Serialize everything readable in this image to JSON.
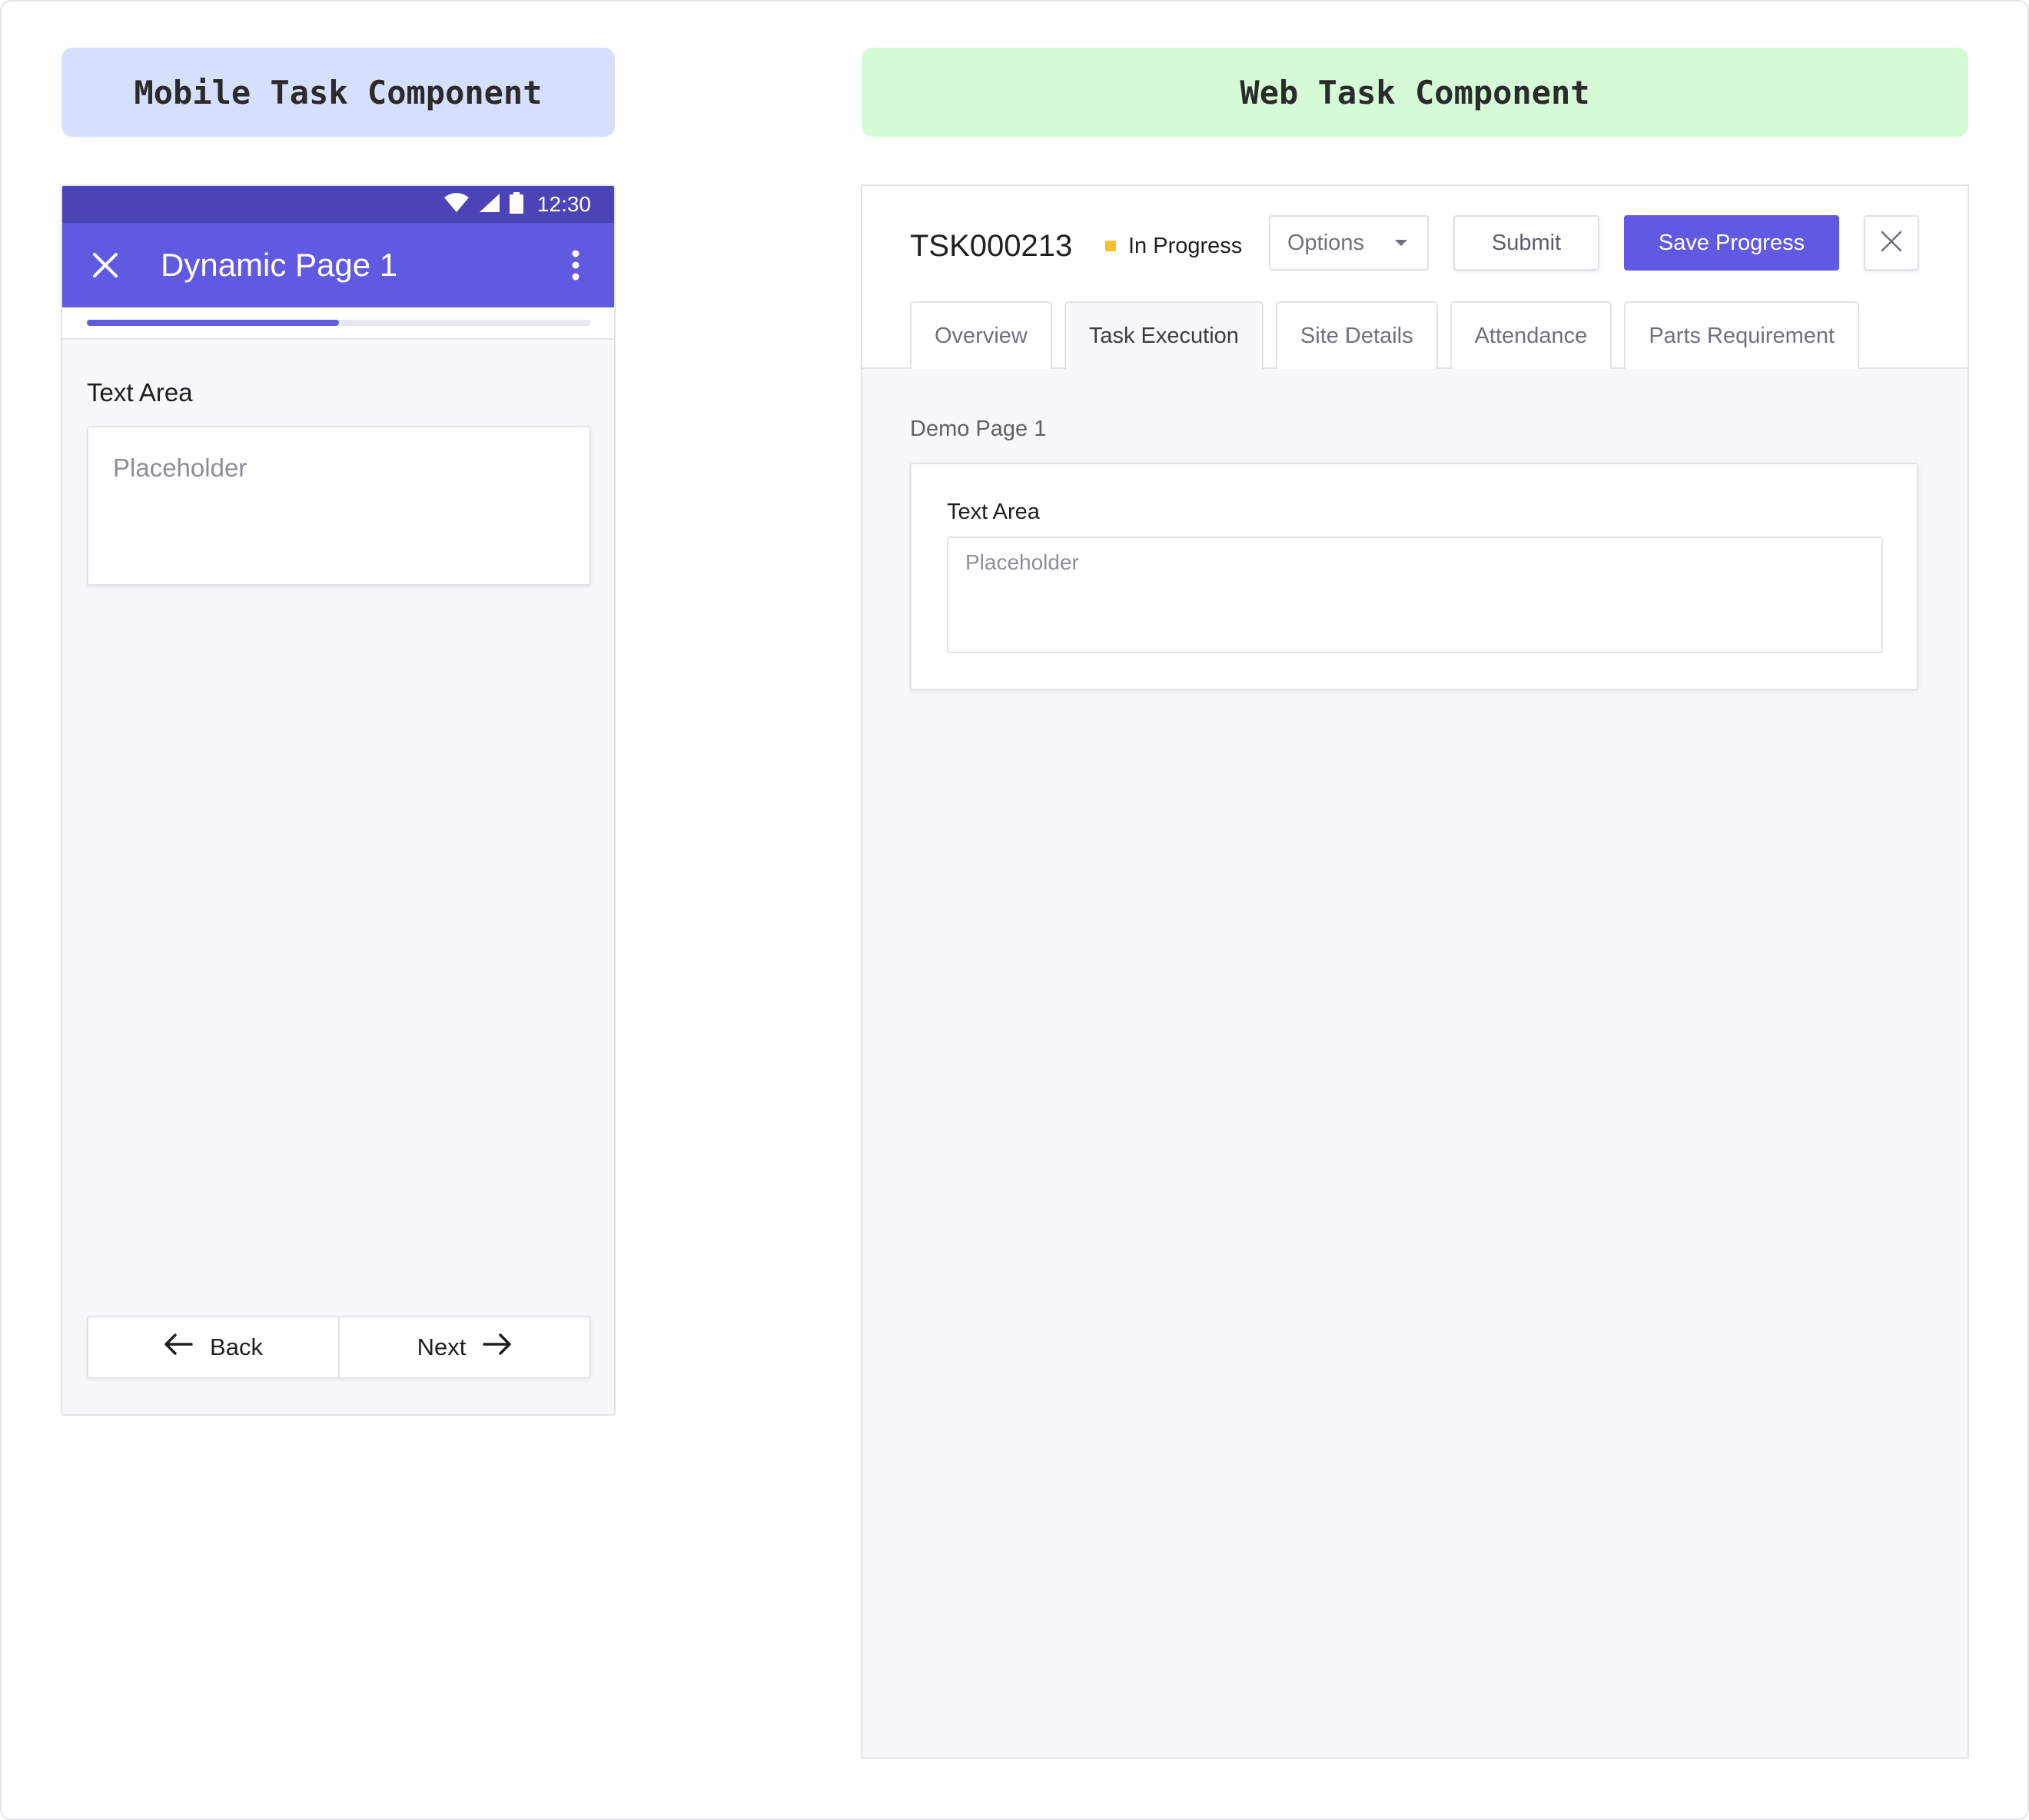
{
  "labels": {
    "mobile": "Mobile Task Component",
    "web": "Web Task Component"
  },
  "mobile": {
    "status_time": "12:30",
    "title": "Dynamic Page 1",
    "progress_fraction": 0.5,
    "field_label": "Text Area",
    "placeholder": "Placeholder",
    "back_label": "Back",
    "next_label": "Next",
    "colors": {
      "statusbar": "#4c44b6",
      "appbar": "#6259e2"
    }
  },
  "web": {
    "task_id": "TSK000213",
    "status": "In Progress",
    "status_color": "#f6c22b",
    "options_label": "Options",
    "submit_label": "Submit",
    "save_label": "Save Progress",
    "tabs": [
      {
        "label": "Overview",
        "active": false
      },
      {
        "label": "Task Execution",
        "active": true
      },
      {
        "label": "Site Details",
        "active": false
      },
      {
        "label": "Attendance",
        "active": false
      },
      {
        "label": "Parts Requirement",
        "active": false
      }
    ],
    "page_title": "Demo Page 1",
    "field_label": "Text Area",
    "placeholder": "Placeholder",
    "accent_color": "#6259e2"
  }
}
